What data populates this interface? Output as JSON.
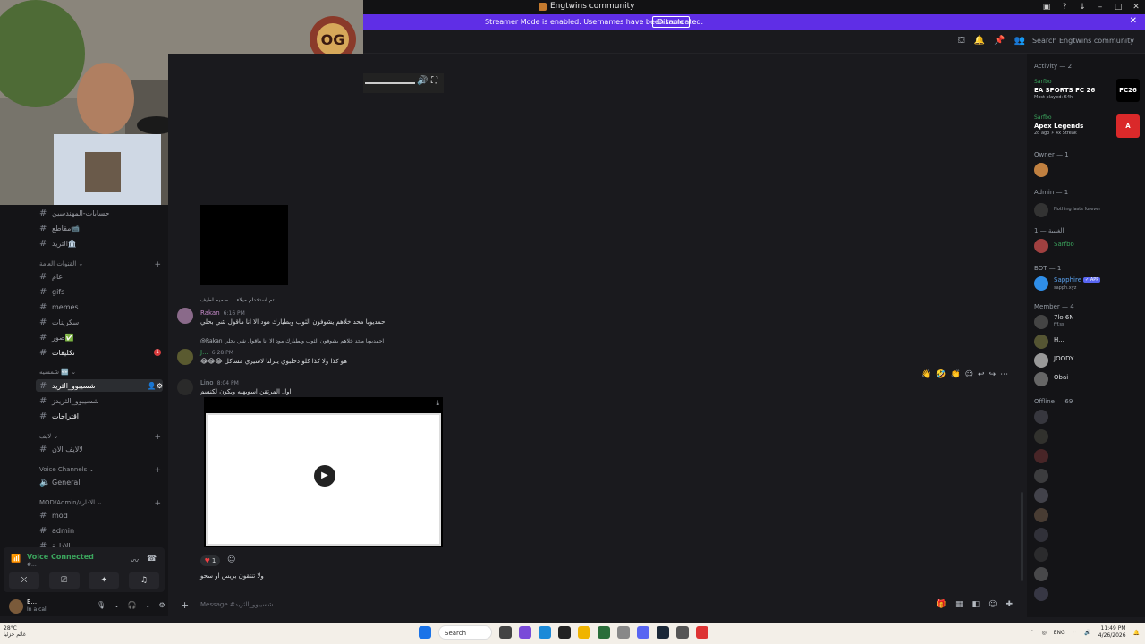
{
  "window": {
    "title": "Engtwins community"
  },
  "streamer": {
    "message": "Streamer Mode is enabled. Usernames have been truncated.",
    "button": "Disable"
  },
  "topbar": {
    "search_placeholder": "Search Engtwins community"
  },
  "sidebar": {
    "channels_top": [
      "حسابات-المهندسين",
      "مقاطع📹",
      "الثريد🏛️"
    ],
    "cat_general": "القنوات العامة",
    "channels_general": [
      "عام",
      "gifs",
      "memes",
      "سكرينات",
      "صور✅",
      "تكليفات"
    ],
    "cat_shams": "شمسيه 🆕",
    "selected_channel": "شسيبوو_الثريد",
    "channels_after": [
      "شسيبوو_الثريدز",
      "اقتراحات"
    ],
    "cat_live": "لايف",
    "channels_live": [
      "لالايف الان"
    ],
    "cat_voice": "Voice Channels",
    "voice_general": "General",
    "cat_mod": "MOD/Admin/الادارة",
    "channels_mod": [
      "mod",
      "admin",
      "الادارة"
    ],
    "unread_count": "1"
  },
  "voice": {
    "status": "Voice Connected",
    "sub": "#..."
  },
  "user": {
    "name": "E...",
    "status": "In a call"
  },
  "chat": {
    "reply1": "تم استخدام ميلاء ...  صميم لطيف",
    "msg1_author": "Rakan",
    "msg1_time": "6:16 PM",
    "msg1_text": "احمديوبا محد خلاهم يشوفون الثوب وبطيارك مود الا انا ماقول شي بحلي",
    "reply2": "@Rakan احمديوبا محد خلاهم يشوفون الثوب وبطيارك مود الا انا ماقول شي بحلي",
    "msg2_author": "J...",
    "msg2_time": "6:28 PM",
    "msg2_text": "😂😂😂 هو كذا ولا كذا كلو دحلبوي يلزلنا لاشيري مشاكل",
    "msg3_author": "Lino",
    "msg3_time": "8:04 PM",
    "msg3_text": "اول المرتقن اسويهيه وبكون لكنسم",
    "reaction_count": "1",
    "msg4_text": "ولا تنتقون بريس او سحو",
    "composer_placeholder": "Message #شسيبوو_الثريد"
  },
  "members": {
    "activity_header": "Activity — 2",
    "activities": [
      {
        "user": "Sarfbo",
        "game": "EA SPORTS FC 26",
        "meta": "Most played: 64h",
        "logo": "FC26",
        "color": "#000000"
      },
      {
        "user": "Sarfbo",
        "game": "Apex Legends",
        "meta": "2d ago  ⚡ 4x Streak",
        "logo": "A",
        "color": "#da292a"
      }
    ],
    "owner_header": "Owner — 1",
    "admin_header": "Admin — 1",
    "admin_sub": "Nothing lasts forever",
    "ghebia_header": "الغيبية — 1",
    "ghebia_member": "Sarfbo",
    "bot_header": "BOT — 1",
    "bot_name": "Sapphire",
    "bot_badge": "✓ APP",
    "bot_sub": "sapph.xyz",
    "member_header": "Member — 4",
    "members": [
      {
        "name": "7lo 6N",
        "sub": "fff.ss"
      },
      {
        "name": "H...",
        "sub": ""
      },
      {
        "name": "JOODY",
        "sub": ""
      },
      {
        "name": "Obai",
        "sub": ""
      }
    ],
    "offline_header": "Offline — 69"
  },
  "taskbar": {
    "weather_temp": "28°C",
    "weather_desc": "غائم جزئيا",
    "search": "Search",
    "lang": "ENG",
    "time": "11:49 PM",
    "date": "4/26/2026"
  }
}
